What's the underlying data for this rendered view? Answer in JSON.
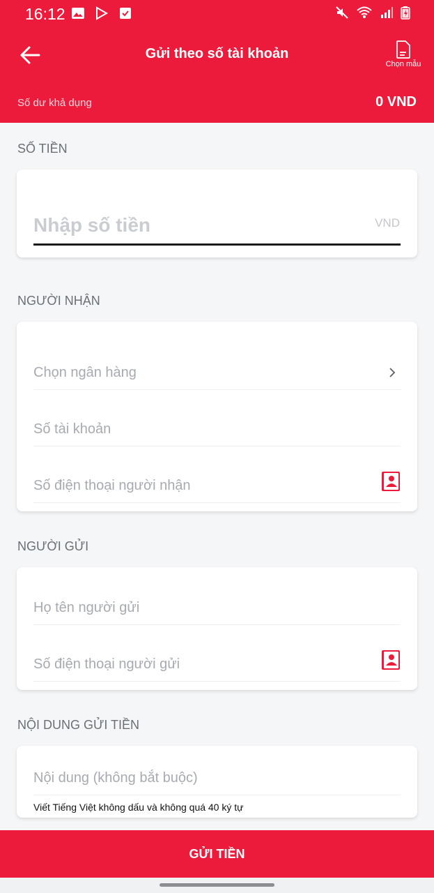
{
  "status_bar": {
    "time": "16:12"
  },
  "header": {
    "title": "Gửi theo số tài khoản",
    "template_label": "Chọn mẫu"
  },
  "balance": {
    "label": "Số dư khả dụng",
    "value": "0 VND"
  },
  "amount_section": {
    "title": "SỐ TIỀN",
    "placeholder": "Nhập số tiền",
    "unit": "VND"
  },
  "recipient_section": {
    "title": "NGƯỜI NHẬN",
    "bank_placeholder": "Chọn ngân hàng",
    "account_placeholder": "Số tài khoản",
    "phone_placeholder": "Số điện thoại người nhận"
  },
  "sender_section": {
    "title": "NGƯỜI GỬI",
    "name_placeholder": "Họ tên người gửi",
    "phone_placeholder": "Số điện thoại người gửi"
  },
  "content_section": {
    "title": "NỘI DUNG GỬI TIỀN",
    "content_placeholder": "Nội dung (không bắt buộc)",
    "note": "Viết Tiếng Việt không dấu và không quá 40 ký tự"
  },
  "submit": {
    "label": "GỬI TIỀN"
  },
  "colors": {
    "brand_red": "#ec1b3b",
    "background": "#f5f6f7"
  },
  "icons": {
    "back": "back-arrow-icon",
    "template": "document-icon",
    "chevron": "chevron-right-icon",
    "contact": "contact-book-icon"
  }
}
